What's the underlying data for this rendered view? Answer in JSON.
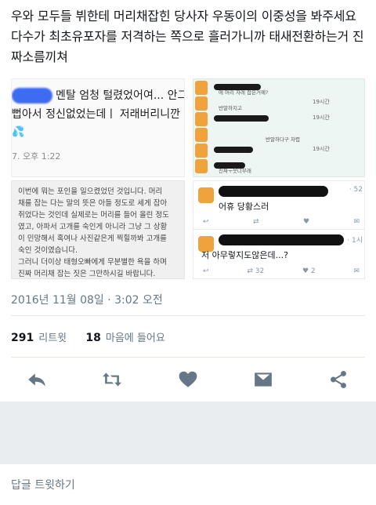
{
  "tweet": {
    "text": "우와 모두들 뷔한테 머리채잡힌 당사자 우동이의 이중성을 봐주세요 다수가 최초유포자를 저격하는 쪽으로 흘러가니까 태새전환하는거 진짜소름끼쳐"
  },
  "media": {
    "top_left": {
      "line1": "멘탈 엄청 털렸었어여... 안그",
      "line2": "뻡아서 정신없었는데ㅣ 저래버리니깐",
      "drops": "💦",
      "time": "7. 오후 1:22"
    },
    "bottom_left": {
      "lines": [
        "이번에 뭐는 포인을 일으켰었던 것입니다. 머리",
        "채를 잡는 다는 말의 뜻은 아들 정도로 세게 잡아",
        "쥐었다는 것인데 실제로는 머리를 들어 올린 정도",
        "였고, 아파서 고개를 숙인게 아니라 그냥 그 상황",
        "이 민망해서 혹여나 사진같은게 찍힐까봐 고개를",
        "숙인 것이였습니다.",
        "그러니 더이상 태형오빠에게 무분별한 욕을 하며",
        "진짜 머리채 잡는 짓은 그만하시길 바랍니다."
      ]
    },
    "top_right": {
      "rows": [
        {
          "text": "에 머리 자레 잡은거예?"
        },
        {
          "text": "반말하지고",
          "meta": "19시간"
        },
        {
          "text": "",
          "meta": "19시간"
        },
        {
          "text": "반말하다구 차렵"
        },
        {
          "text": "",
          "meta": "19시간"
        },
        {
          "text": "진짜ㅜ웃너무래"
        }
      ]
    },
    "bottom_right": {
      "reply1": {
        "body": "어휴 당황스러",
        "meta": "· 52",
        "retweets": "",
        "likes": ""
      },
      "reply2": {
        "body": "저 아무렇지도않은데...?",
        "meta": "· 1시",
        "retweets": "32",
        "likes": "2"
      }
    }
  },
  "meta": {
    "date": "2016년 11월 08일 · 3:02 오전",
    "retweet_count": "291",
    "retweet_label": "리트윗",
    "like_count": "18",
    "like_label": "마음에 들어요"
  },
  "icons": [
    "reply-icon",
    "retweet-icon",
    "heart-icon",
    "dm-icon",
    "share-icon"
  ],
  "reply_placeholder": "답글 트윗하기",
  "colors": {
    "icon": "#657786",
    "text": "#14171a",
    "muted": "#657786",
    "panel": "#e9edf0"
  }
}
